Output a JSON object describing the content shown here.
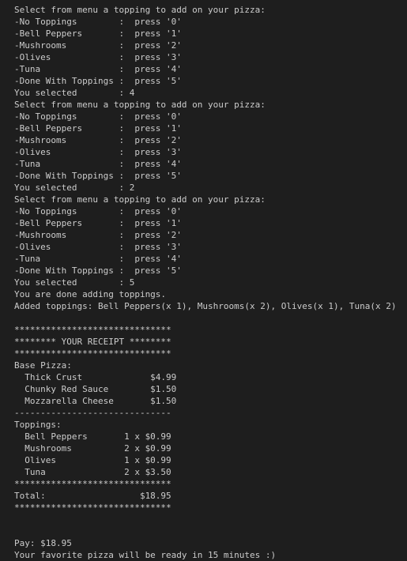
{
  "terminal": {
    "lines": [
      "Select from menu a topping to add on your pizza:",
      "-No Toppings        :  press '0'",
      "-Bell Peppers       :  press '1'",
      "-Mushrooms          :  press '2'",
      "-Olives             :  press '3'",
      "-Tuna               :  press '4'",
      "-Done With Toppings :  press '5'",
      "You selected        : 4",
      "Select from menu a topping to add on your pizza:",
      "-No Toppings        :  press '0'",
      "-Bell Peppers       :  press '1'",
      "-Mushrooms          :  press '2'",
      "-Olives             :  press '3'",
      "-Tuna               :  press '4'",
      "-Done With Toppings :  press '5'",
      "You selected        : 2",
      "Select from menu a topping to add on your pizza:",
      "-No Toppings        :  press '0'",
      "-Bell Peppers       :  press '1'",
      "-Mushrooms          :  press '2'",
      "-Olives             :  press '3'",
      "-Tuna               :  press '4'",
      "-Done With Toppings :  press '5'",
      "You selected        : 5",
      "You are done adding toppings.",
      "Added toppings: Bell Peppers(x 1), Mushrooms(x 2), Olives(x 1), Tuna(x 2)",
      "",
      "******************************",
      "******** YOUR RECEIPT ********",
      "******************************",
      "Base Pizza:",
      "  Thick Crust             $4.99",
      "  Chunky Red Sauce        $1.50",
      "  Mozzarella Cheese       $1.50",
      "------------------------------",
      "Toppings:",
      "  Bell Peppers       1 x $0.99",
      "  Mushrooms          2 x $0.99",
      "  Olives             1 x $0.99",
      "  Tuna               2 x $3.50",
      "******************************",
      "Total:                  $18.95",
      "******************************",
      "",
      "",
      "Pay: $18.95",
      "Your favorite pizza will be ready in 15 minutes :)"
    ]
  }
}
